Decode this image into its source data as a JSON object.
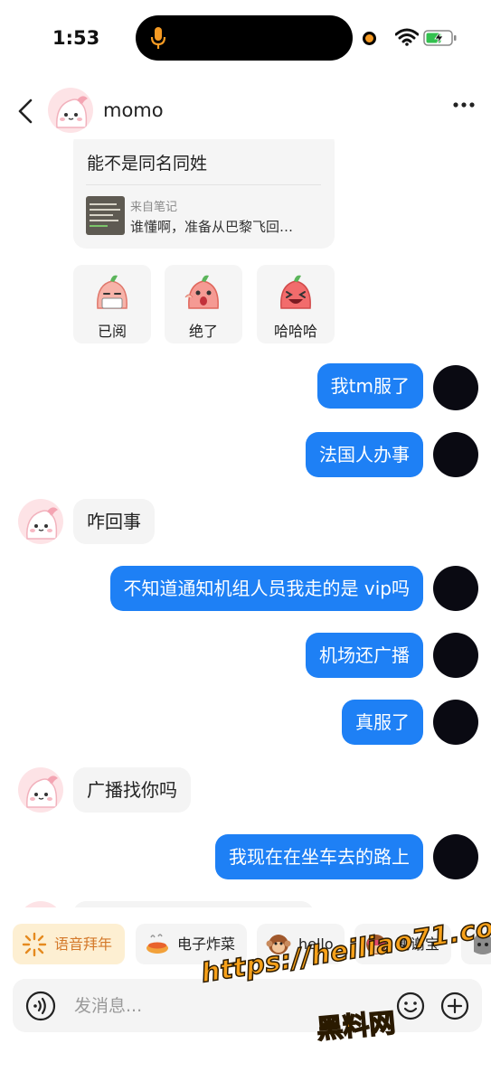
{
  "status_bar": {
    "time": "1:53"
  },
  "header": {
    "contact_name": "momo"
  },
  "shared_note": {
    "message": "能不是同名同姓",
    "source_label": "来自笔记",
    "snippet": "谁懂啊，准备从巴黎飞回…"
  },
  "sticker_replies": [
    {
      "label": "已阅"
    },
    {
      "label": "绝了"
    },
    {
      "label": "哈哈哈"
    }
  ],
  "messages": [
    {
      "side": "out",
      "text": "我tm服了"
    },
    {
      "side": "out",
      "text": "法国人办事"
    },
    {
      "side": "in",
      "text": "咋回事"
    },
    {
      "side": "out",
      "text": "不知道通知机组人员我走的是 vip吗"
    },
    {
      "side": "out",
      "text": "机场还广播"
    },
    {
      "side": "out",
      "text": "真服了"
    },
    {
      "side": "in",
      "text": "广播找你吗"
    },
    {
      "side": "out",
      "text": "我现在在坐车去的路上"
    }
  ],
  "quick_replies": [
    {
      "label": "语音拜年",
      "icon": "sparkle-icon"
    },
    {
      "label": "电子炸菜",
      "icon": "dish-icon"
    },
    {
      "label": "hello",
      "icon": "monkey-icon"
    },
    {
      "label": "谢谢宝",
      "icon": "monkey-cover-eyes-icon"
    }
  ],
  "input": {
    "placeholder": "发消息..."
  },
  "watermark": {
    "url": "https://heiliao71.com",
    "name": "黑料网"
  },
  "colors": {
    "outgoing_bubble": "#1e80f5",
    "incoming_bubble": "#f4f4f4",
    "accent_chip": "#fdefd2",
    "accent_text": "#d4792a",
    "watermark": "#f7a11a"
  }
}
